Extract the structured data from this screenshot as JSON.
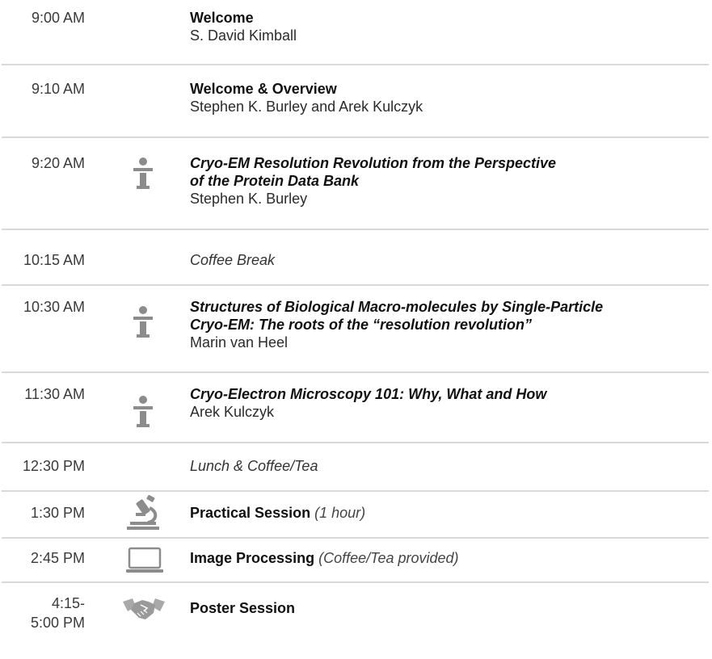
{
  "colors": {
    "text": "#1a1a1a",
    "time_text": "#3a3a3a",
    "divider": "#d9d9d9",
    "icon_gray": "#8c8c8c"
  },
  "rows": [
    {
      "time": "9:00 AM",
      "title": "Welcome",
      "speaker": "S. David Kimball",
      "icon": ""
    },
    {
      "time": "9:10 AM",
      "title": "Welcome & Overview",
      "speaker": "Stephen K. Burley and Arek Kulczyk",
      "icon": ""
    },
    {
      "time": "9:20 AM",
      "title_line1": "Cryo-EM Resolution Revolution from the Perspective",
      "title_line2": "of the Protein Data Bank",
      "speaker": "Stephen K. Burley",
      "icon": "speaker-podium-icon"
    },
    {
      "time": "10:15 AM",
      "title": "Coffee Break",
      "icon": ""
    },
    {
      "time": "10:30 AM",
      "title_line1": "Structures of Biological Macro-molecules by Single-Particle",
      "title_line2": "Cryo-EM: The roots of the “resolution revolution”",
      "speaker": "Marin van Heel",
      "icon": "speaker-podium-icon"
    },
    {
      "time": "11:30 AM",
      "title": "Cryo-Electron Microscopy 101: Why, What and How",
      "speaker": "Arek Kulczyk",
      "icon": "speaker-podium-icon"
    },
    {
      "time": "12:30 PM",
      "title": "Lunch & Coffee/Tea",
      "icon": ""
    },
    {
      "time": "1:30 PM",
      "title": "Practical Session",
      "note": "(1 hour)",
      "icon": "microscope-icon"
    },
    {
      "time": "2:45 PM",
      "title": "Image Processing",
      "note": "(Coffee/Tea provided)",
      "icon": "laptop-icon"
    },
    {
      "time_line1": "4:15-",
      "time_line2": "5:00 PM",
      "title": "Poster Session",
      "icon": "handshake-icon"
    }
  ]
}
